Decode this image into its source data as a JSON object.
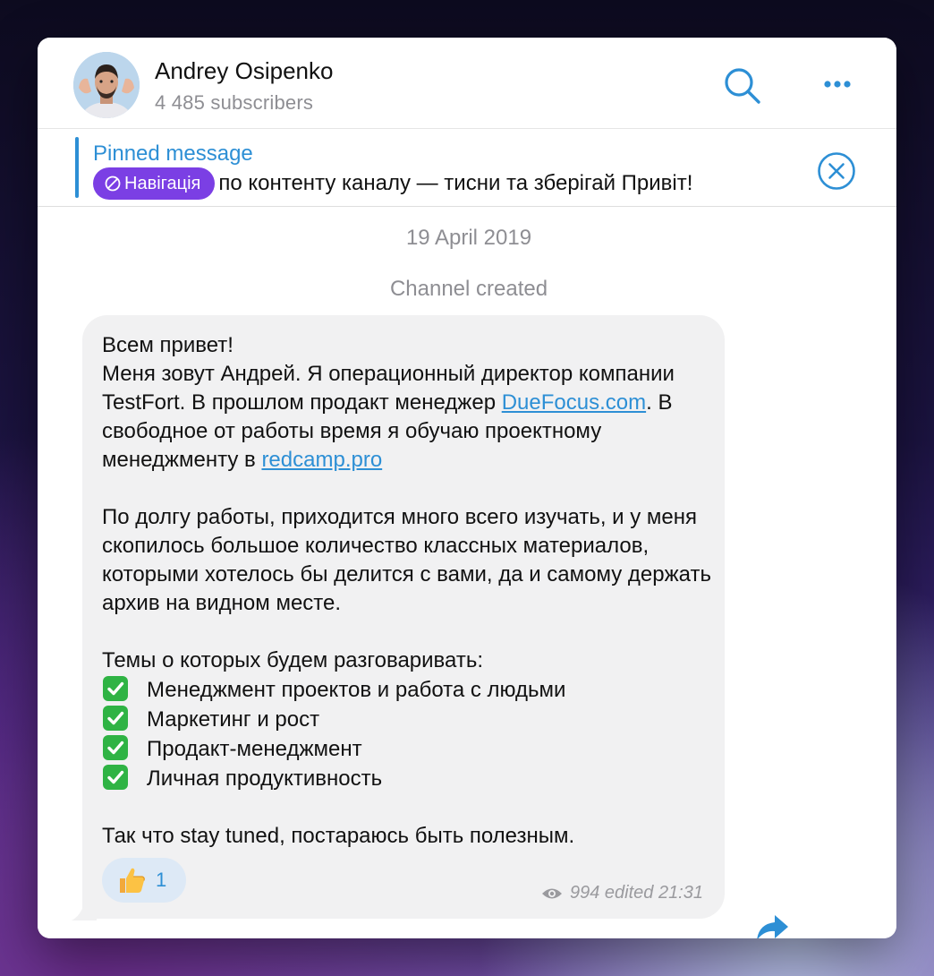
{
  "header": {
    "title": "Andrey Osipenko",
    "subtitle": "4 485 subscribers",
    "search_icon": "search-icon",
    "more_icon": "more-dots-icon"
  },
  "pinned": {
    "title": "Pinned message",
    "tag_label": "Навігація",
    "text": "по контенту каналу — тисни та зберігай  Привіт!",
    "close_icon": "close-circle-icon"
  },
  "chat": {
    "date": "19 April 2019",
    "service_text": "Channel created"
  },
  "message": {
    "greeting": "Всем привет!",
    "intro_1": "Меня зовут Андрей. Я операционный директор компании TestFort. В прошлом продакт менеджер ",
    "link_1": "DueFocus.com",
    "intro_2": ". В свободное от работы время я обучаю проектному менеджменту в ",
    "link_2": "redcamp.pro",
    "para_2": "По долгу работы, приходится много всего изучать, и у меня скопилось большое количество классных материалов, которыми хотелось бы делится с вами, да и самому держать архив на видном месте.",
    "topics_title": "Темы о которых будем разговаривать:",
    "topics": [
      "Менеджмент проектов и работа с людьми",
      "Маркетинг и рост",
      "Продакт-менеджмент",
      "Личная продуктивность"
    ],
    "closing": "Так что stay tuned, постараюсь быть полезным.",
    "reaction_emoji": "👍",
    "reaction_count": "1",
    "views": "994",
    "meta_text": "edited 21:31",
    "share_icon": "share-arrow-icon"
  },
  "colors": {
    "accent": "#2d8fd5",
    "pill": "#7b3fe4",
    "bubble": "#f1f1f2",
    "check_green": "#2fb344"
  }
}
